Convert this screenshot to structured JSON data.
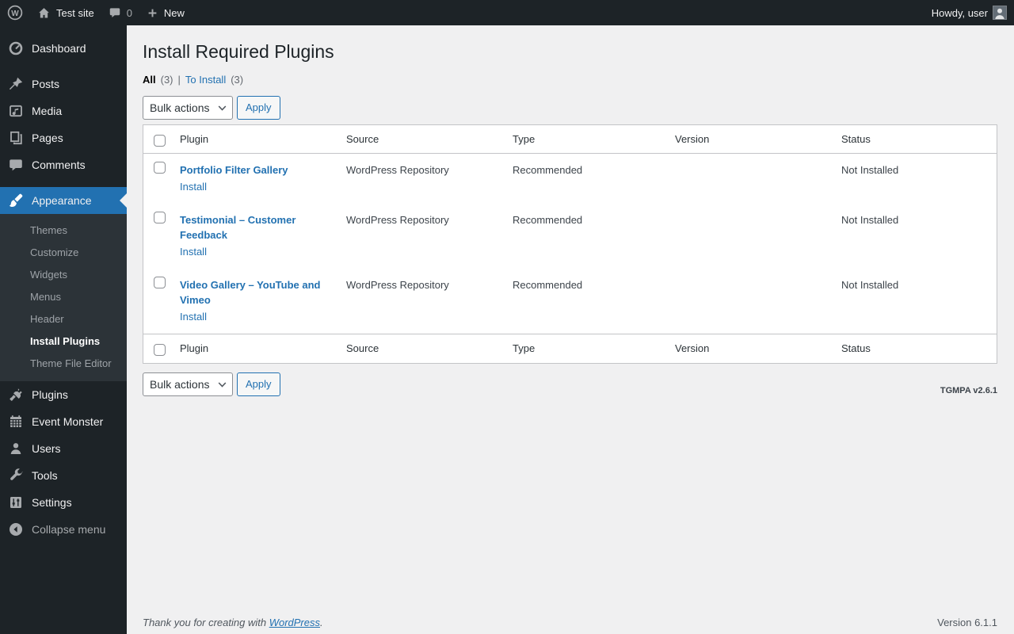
{
  "admin_bar": {
    "site_name": "Test site",
    "comment_count": "0",
    "new_label": "New",
    "howdy_text": "Howdy, user"
  },
  "sidebar": {
    "top_items": [
      {
        "label": "Dashboard"
      },
      {
        "label": "Posts"
      },
      {
        "label": "Media"
      },
      {
        "label": "Pages"
      },
      {
        "label": "Comments"
      },
      {
        "label": "Appearance"
      }
    ],
    "appearance_submenu": [
      {
        "label": "Themes"
      },
      {
        "label": "Customize"
      },
      {
        "label": "Widgets"
      },
      {
        "label": "Menus"
      },
      {
        "label": "Header"
      },
      {
        "label": "Install Plugins"
      },
      {
        "label": "Theme File Editor"
      }
    ],
    "bottom_items": [
      {
        "label": "Plugins"
      },
      {
        "label": "Event Monster"
      },
      {
        "label": "Users"
      },
      {
        "label": "Tools"
      },
      {
        "label": "Settings"
      }
    ],
    "collapse_label": "Collapse menu"
  },
  "page": {
    "title": "Install Required Plugins",
    "filter_all_label": "All",
    "filter_all_count": "(3)",
    "filter_separator": "|",
    "filter_to_install_label": "To Install",
    "filter_to_install_count": "(3)",
    "bulk_actions_label": "Bulk actions",
    "apply_label": "Apply",
    "tgmpa_version": "TGMPA v2.6.1"
  },
  "table": {
    "columns": {
      "plugin": "Plugin",
      "source": "Source",
      "type": "Type",
      "version": "Version",
      "status": "Status"
    },
    "rows": [
      {
        "plugin": "Portfolio Filter Gallery",
        "action": "Install",
        "source": "WordPress Repository",
        "type": "Recommended",
        "version": "",
        "status": "Not Installed"
      },
      {
        "plugin": "Testimonial – Customer Feedback",
        "action": "Install",
        "source": "WordPress Repository",
        "type": "Recommended",
        "version": "",
        "status": "Not Installed"
      },
      {
        "plugin": "Video Gallery – YouTube and Vimeo",
        "action": "Install",
        "source": "WordPress Repository",
        "type": "Recommended",
        "version": "",
        "status": "Not Installed"
      }
    ]
  },
  "footer": {
    "thanks_text": "Thank you for creating with",
    "wordpress_link": "WordPress",
    "suffix": ".",
    "version_text": "Version 6.1.1"
  },
  "colors": {
    "admin_bar_bg": "#1d2327",
    "sidebar_bg": "#1d2327",
    "submenu_bg": "#2c3338",
    "accent_blue": "#2271b1",
    "content_bg": "#f0f0f1",
    "table_border": "#c3c4c7",
    "muted_text": "#646970"
  }
}
